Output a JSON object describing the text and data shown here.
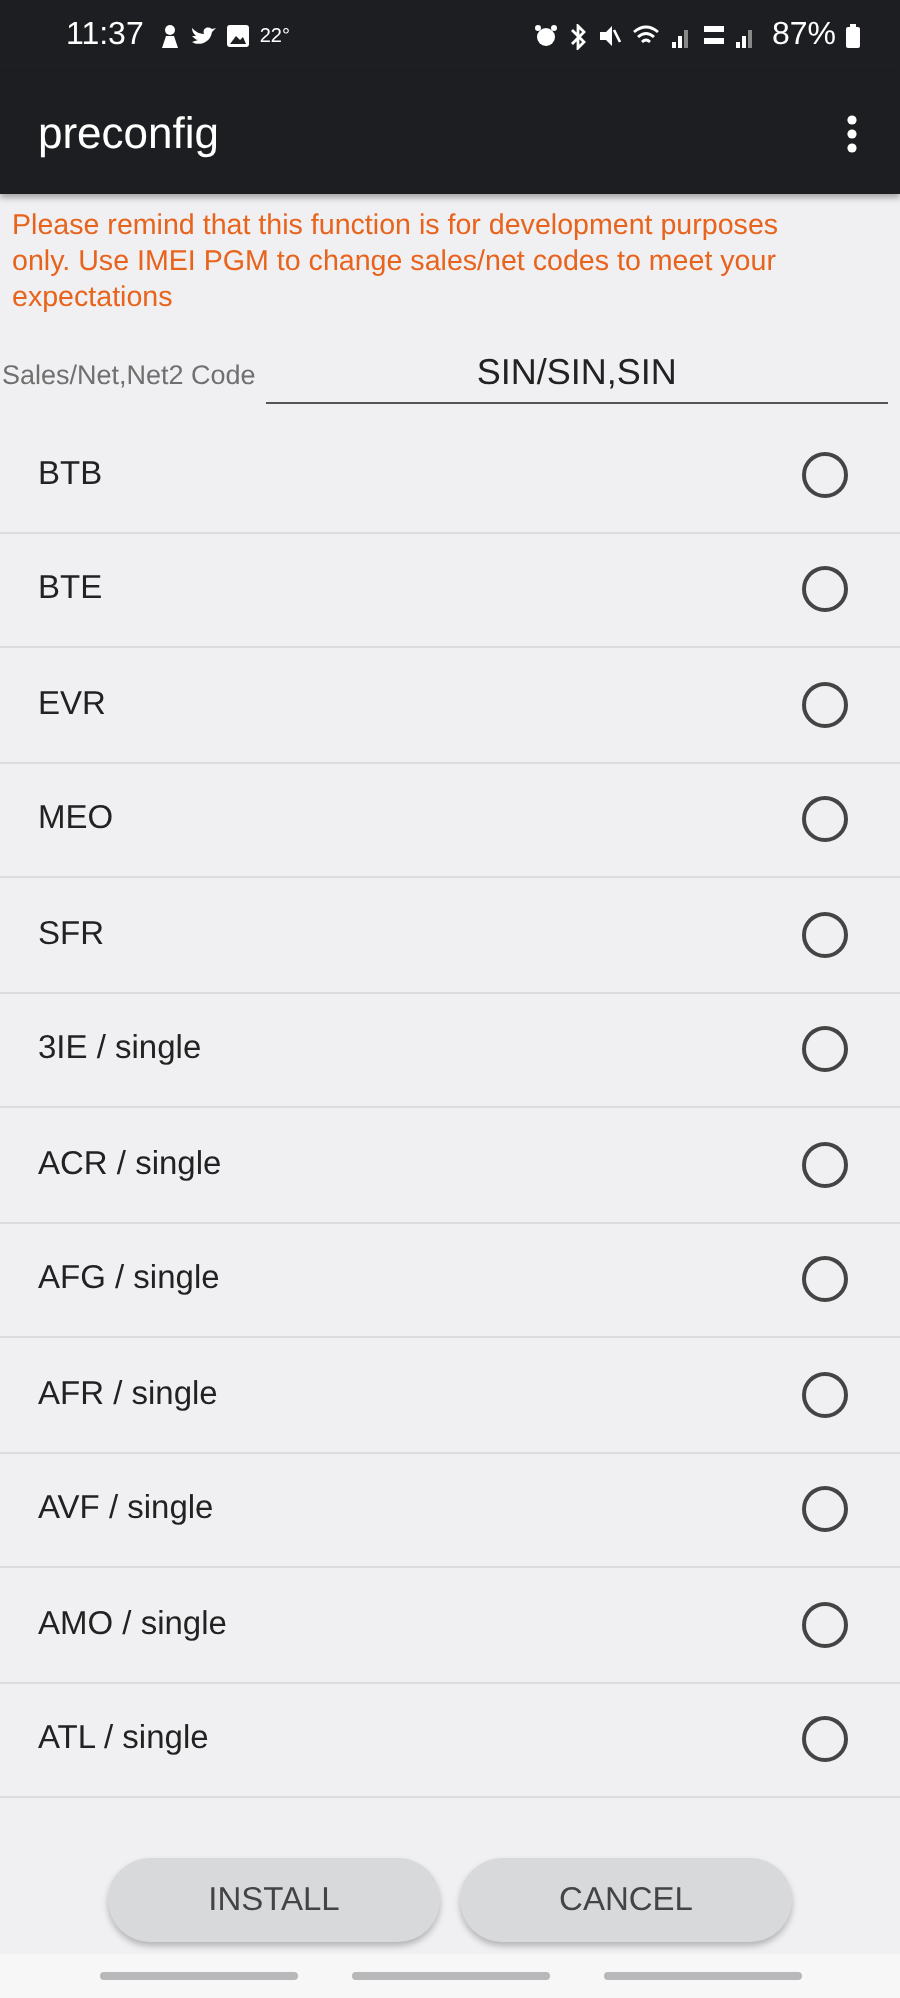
{
  "status_bar": {
    "time": "11:37",
    "temperature": "22°",
    "battery": "87%"
  },
  "app_bar": {
    "title": "preconfig"
  },
  "warning": "Please remind that this function is for development purposes only. Use IMEI PGM to change sales/net codes to meet your expectations",
  "code_field": {
    "label": "Sales/Net,Net2 Code",
    "value": "SIN/SIN,SIN"
  },
  "options": [
    {
      "label": "BTB",
      "selected": false
    },
    {
      "label": "BTE",
      "selected": false
    },
    {
      "label": "EVR",
      "selected": false
    },
    {
      "label": "MEO",
      "selected": false
    },
    {
      "label": "SFR",
      "selected": false
    },
    {
      "label": "3IE / single",
      "selected": false
    },
    {
      "label": "ACR / single",
      "selected": false
    },
    {
      "label": "AFG / single",
      "selected": false
    },
    {
      "label": "AFR / single",
      "selected": false
    },
    {
      "label": "AVF / single",
      "selected": false
    },
    {
      "label": "AMO / single",
      "selected": false
    },
    {
      "label": "ATL / single",
      "selected": false
    }
  ],
  "buttons": [
    "INSTALL",
    "CANCEL"
  ]
}
